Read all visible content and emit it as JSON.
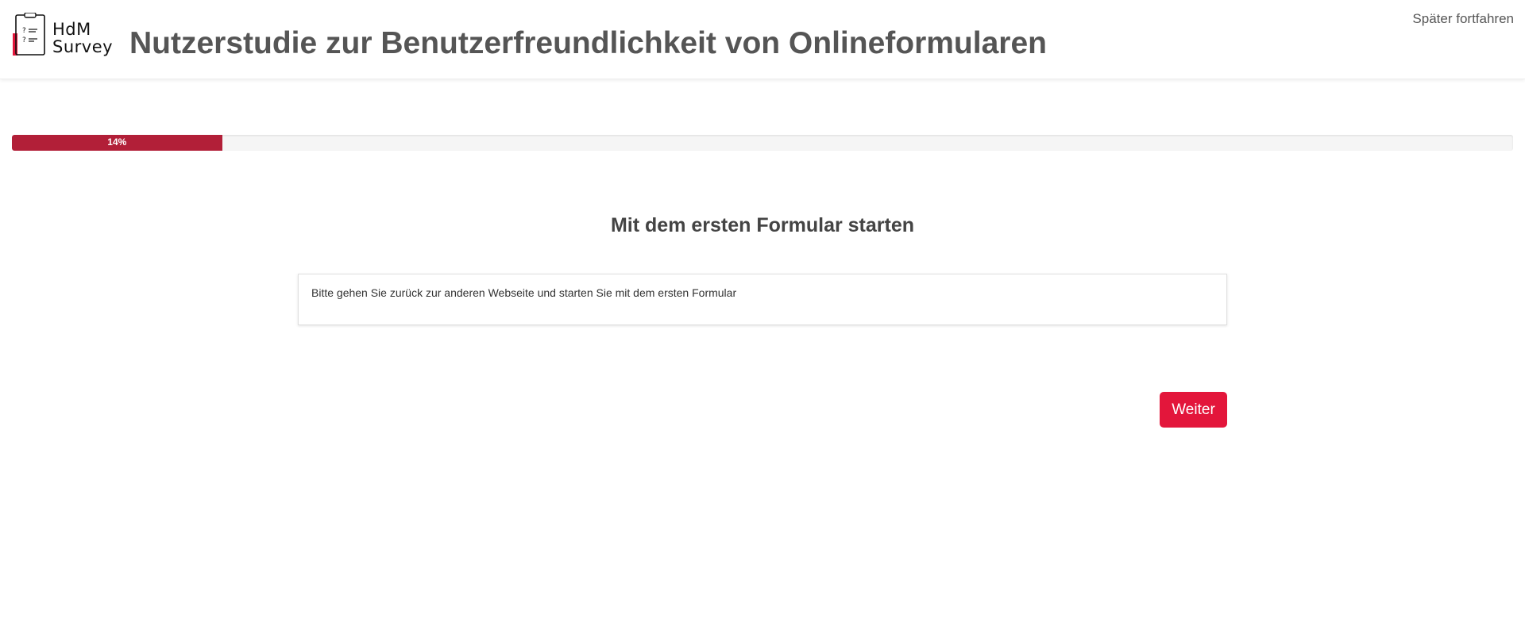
{
  "header": {
    "logo": {
      "line1": "HdM",
      "line2": "Survey",
      "icon": "clipboard-icon",
      "accent_color": "#e3163b"
    },
    "title": "Nutzerstudie zur Benutzerfreundlichkeit von Onlineformularen",
    "later_link": "Später fortfahren"
  },
  "progress": {
    "percent": 14,
    "label": "14%",
    "fill_color": "#b21f38"
  },
  "main": {
    "section_title": "Mit dem ersten Formular starten",
    "instruction": "Bitte gehen Sie zurück zur anderen Webseite und starten Sie mit dem ersten Formular"
  },
  "actions": {
    "next_label": "Weiter",
    "next_color": "#e3163b"
  }
}
